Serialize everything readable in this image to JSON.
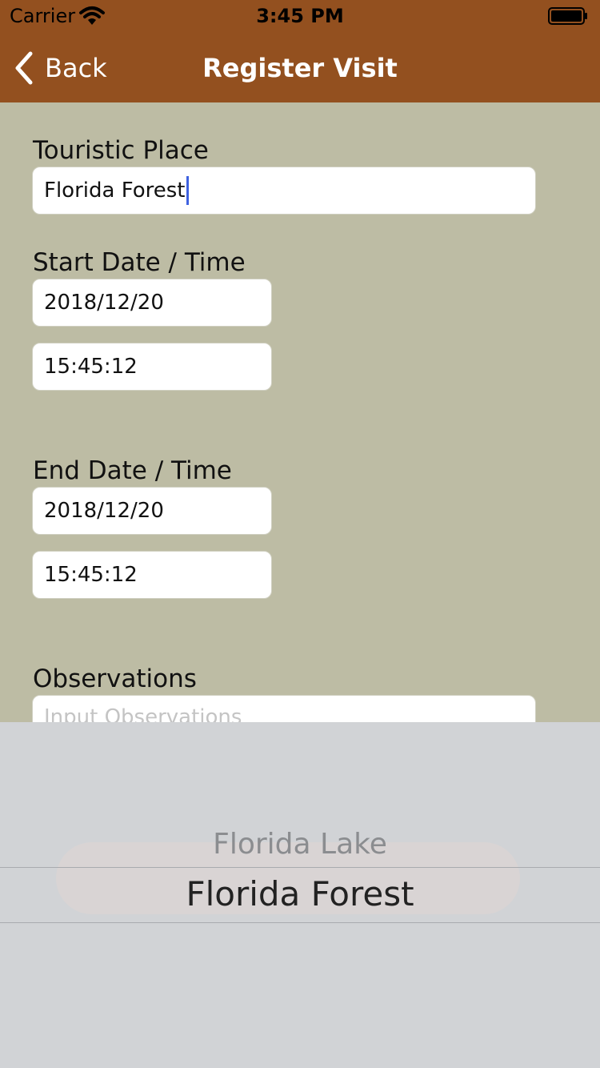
{
  "status_bar": {
    "carrier": "Carrier",
    "time": "3:45 PM"
  },
  "nav": {
    "back_label": "Back",
    "title": "Register Visit"
  },
  "form": {
    "touristic_place": {
      "label": "Touristic Place",
      "value": "Florida Forest"
    },
    "start": {
      "label": "Start Date / Time",
      "date": "2018/12/20",
      "time": "15:45:12"
    },
    "end": {
      "label": "End Date / Time",
      "date": "2018/12/20",
      "time": "15:45:12"
    },
    "observations": {
      "label": "Observations",
      "placeholder": "Input Observations"
    }
  },
  "picker": {
    "options": [
      "Florida Lake",
      "Florida Forest"
    ],
    "selected": "Florida Forest"
  },
  "colors": {
    "nav_background": "#93501f",
    "page_background": "#bdbca4",
    "picker_background": "#d1d3d6",
    "caret": "#3f62e0"
  },
  "icons": {
    "wifi": "wifi-icon",
    "battery": "battery-icon",
    "back": "chevron-left-icon"
  }
}
